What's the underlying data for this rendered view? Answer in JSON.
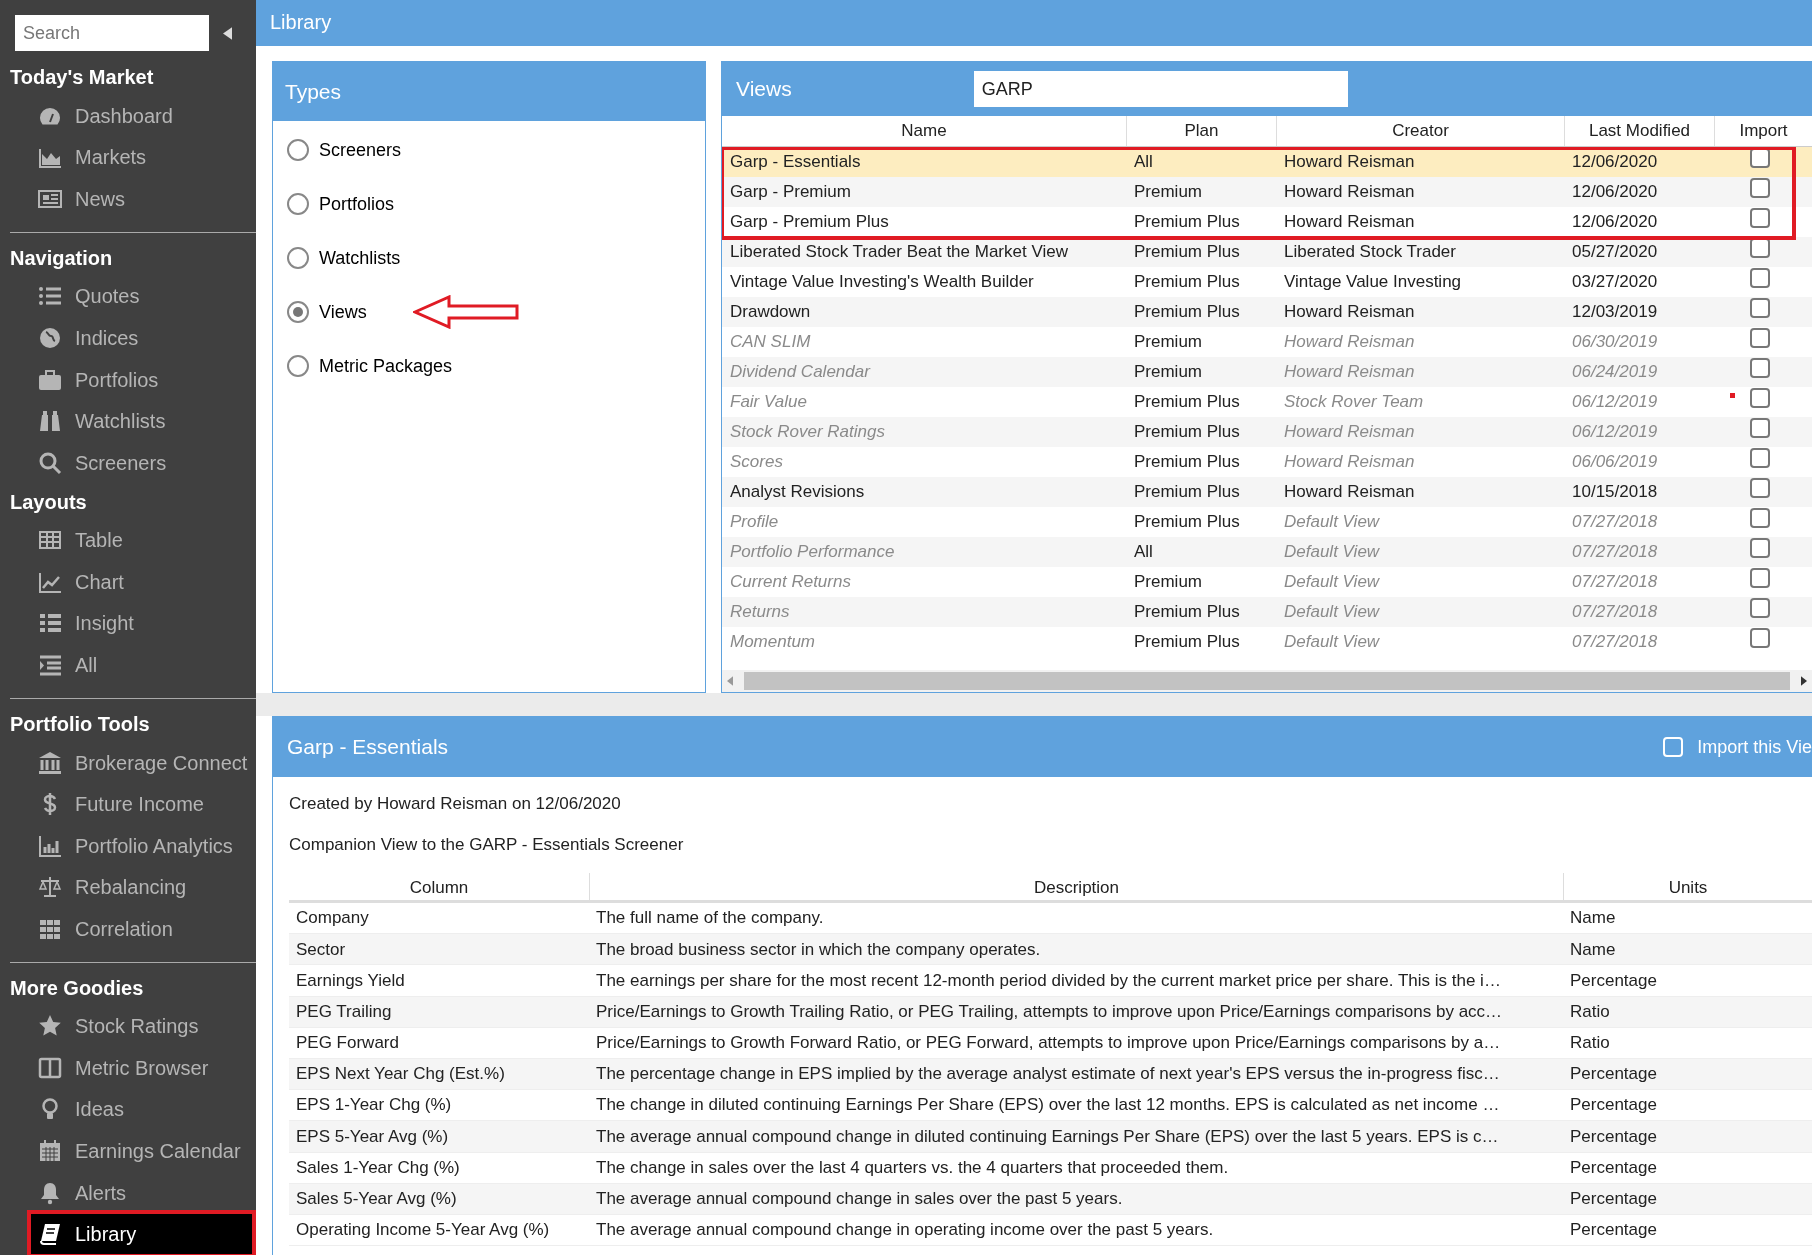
{
  "header": {
    "title": "Library"
  },
  "sidebar": {
    "search": {
      "placeholder": "Search"
    },
    "sections": [
      {
        "title": "Today's Market",
        "divider": false,
        "items": [
          {
            "label": "Dashboard",
            "selected": false,
            "outlined": false
          },
          {
            "label": "Markets",
            "selected": false,
            "outlined": false
          },
          {
            "label": "News",
            "selected": false,
            "outlined": false
          }
        ]
      },
      {
        "title": "Navigation",
        "divider": true,
        "items": [
          {
            "label": "Quotes",
            "selected": false,
            "outlined": false
          },
          {
            "label": "Indices",
            "selected": false,
            "outlined": false
          },
          {
            "label": "Portfolios",
            "selected": false,
            "outlined": false
          },
          {
            "label": "Watchlists",
            "selected": false,
            "outlined": false
          },
          {
            "label": "Screeners",
            "selected": false,
            "outlined": false
          }
        ]
      },
      {
        "title": "Layouts",
        "divider": false,
        "items": [
          {
            "label": "Table",
            "selected": false,
            "outlined": false
          },
          {
            "label": "Chart",
            "selected": false,
            "outlined": false
          },
          {
            "label": "Insight",
            "selected": false,
            "outlined": false
          },
          {
            "label": "All",
            "selected": false,
            "outlined": false
          }
        ]
      },
      {
        "title": "Portfolio Tools",
        "divider": true,
        "items": [
          {
            "label": "Brokerage Connect",
            "selected": false,
            "outlined": false
          },
          {
            "label": "Future Income",
            "selected": false,
            "outlined": false
          },
          {
            "label": "Portfolio Analytics",
            "selected": false,
            "outlined": false
          },
          {
            "label": "Rebalancing",
            "selected": false,
            "outlined": false
          },
          {
            "label": "Correlation",
            "selected": false,
            "outlined": false
          }
        ]
      },
      {
        "title": "More Goodies",
        "divider": true,
        "items": [
          {
            "label": "Stock Ratings",
            "selected": false,
            "outlined": false
          },
          {
            "label": "Metric Browser",
            "selected": false,
            "outlined": false
          },
          {
            "label": "Ideas",
            "selected": false,
            "outlined": false
          },
          {
            "label": "Earnings Calendar",
            "selected": false,
            "outlined": false
          },
          {
            "label": "Alerts",
            "selected": false,
            "outlined": false
          },
          {
            "label": "Library",
            "selected": true,
            "outlined": true
          }
        ]
      }
    ]
  },
  "types": {
    "title": "Types",
    "options": [
      {
        "label": "Screeners",
        "selected": false,
        "arrow": false
      },
      {
        "label": "Portfolios",
        "selected": false,
        "arrow": false
      },
      {
        "label": "Watchlists",
        "selected": false,
        "arrow": false
      },
      {
        "label": "Views",
        "selected": true,
        "arrow": true
      },
      {
        "label": "Metric Packages",
        "selected": false,
        "arrow": false
      }
    ]
  },
  "views": {
    "title": "Views",
    "search": {
      "value": "GARP"
    },
    "columns": [
      "Name",
      "Plan",
      "Creator",
      "Last Modified",
      "Import"
    ],
    "rows": [
      {
        "name": "Garp - Essentials",
        "plan": "All",
        "creator": "Howard Reisman",
        "modified": "12/06/2020",
        "import": false,
        "selected": true,
        "dimmed": false,
        "outlined": true
      },
      {
        "name": "Garp - Premium",
        "plan": "Premium",
        "creator": "Howard Reisman",
        "modified": "12/06/2020",
        "import": false,
        "selected": false,
        "dimmed": false,
        "outlined": true
      },
      {
        "name": "Garp - Premium Plus",
        "plan": "Premium Plus",
        "creator": "Howard Reisman",
        "modified": "12/06/2020",
        "import": false,
        "selected": false,
        "dimmed": false,
        "outlined": true
      },
      {
        "name": "Liberated Stock Trader Beat the Market View",
        "plan": "Premium Plus",
        "creator": "Liberated Stock Trader",
        "modified": "05/27/2020",
        "import": false,
        "selected": false,
        "dimmed": false,
        "outlined": false
      },
      {
        "name": "Vintage Value Investing's Wealth Builder",
        "plan": "Premium Plus",
        "creator": "Vintage Value Investing",
        "modified": "03/27/2020",
        "import": false,
        "selected": false,
        "dimmed": false,
        "outlined": false
      },
      {
        "name": "Drawdown",
        "plan": "Premium Plus",
        "creator": "Howard Reisman",
        "modified": "12/03/2019",
        "import": false,
        "selected": false,
        "dimmed": false,
        "outlined": false
      },
      {
        "name": "CAN SLIM",
        "plan": "Premium",
        "creator": "Howard Reisman",
        "modified": "06/30/2019",
        "import": false,
        "selected": false,
        "dimmed": true,
        "outlined": false
      },
      {
        "name": "Dividend Calendar",
        "plan": "Premium",
        "creator": "Howard Reisman",
        "modified": "06/24/2019",
        "import": false,
        "selected": false,
        "dimmed": true,
        "outlined": false
      },
      {
        "name": "Fair Value",
        "plan": "Premium Plus",
        "creator": "Stock Rover Team",
        "modified": "06/12/2019",
        "import": false,
        "selected": false,
        "dimmed": true,
        "outlined": false
      },
      {
        "name": "Stock Rover Ratings",
        "plan": "Premium Plus",
        "creator": "Howard Reisman",
        "modified": "06/12/2019",
        "import": false,
        "selected": false,
        "dimmed": true,
        "outlined": false
      },
      {
        "name": "Scores",
        "plan": "Premium Plus",
        "creator": "Howard Reisman",
        "modified": "06/06/2019",
        "import": false,
        "selected": false,
        "dimmed": true,
        "outlined": false
      },
      {
        "name": "Analyst Revisions",
        "plan": "Premium Plus",
        "creator": "Howard Reisman",
        "modified": "10/15/2018",
        "import": false,
        "selected": false,
        "dimmed": false,
        "outlined": false
      },
      {
        "name": "Profile",
        "plan": "Premium Plus",
        "creator": "Default View",
        "modified": "07/27/2018",
        "import": false,
        "selected": false,
        "dimmed": true,
        "outlined": false
      },
      {
        "name": "Portfolio Performance",
        "plan": "All",
        "creator": "Default View",
        "modified": "07/27/2018",
        "import": false,
        "selected": false,
        "dimmed": true,
        "outlined": false
      },
      {
        "name": "Current Returns",
        "plan": "Premium",
        "creator": "Default View",
        "modified": "07/27/2018",
        "import": false,
        "selected": false,
        "dimmed": true,
        "outlined": false
      },
      {
        "name": "Returns",
        "plan": "Premium Plus",
        "creator": "Default View",
        "modified": "07/27/2018",
        "import": false,
        "selected": false,
        "dimmed": true,
        "outlined": false
      },
      {
        "name": "Momentum",
        "plan": "Premium Plus",
        "creator": "Default View",
        "modified": "07/27/2018",
        "import": false,
        "selected": false,
        "dimmed": true,
        "outlined": false
      }
    ]
  },
  "detail": {
    "title": "Garp - Essentials",
    "import_label": "Import this Vie",
    "import_checked": false,
    "created": "Created by Howard Reisman on 12/06/2020",
    "note": "Companion View to the GARP - Essentials Screener",
    "columns": [
      "Column",
      "Description",
      "Units"
    ],
    "rows": [
      {
        "column": "Company",
        "description": "The full name of the company.",
        "units": "Name"
      },
      {
        "column": "Sector",
        "description": "The broad business sector in which the company operates.",
        "units": "Name"
      },
      {
        "column": "Earnings Yield",
        "description": "The earnings per share for the most recent 12-month period divided by the current market price per share. This is the i…",
        "units": "Percentage"
      },
      {
        "column": "PEG Trailing",
        "description": "Price/Earnings to Growth Trailing Ratio, or PEG Trailing, attempts to improve upon Price/Earnings comparisons by acc…",
        "units": "Ratio"
      },
      {
        "column": "PEG Forward",
        "description": "Price/Earnings to Growth Forward Ratio, or PEG Forward, attempts to improve upon Price/Earnings comparisons by a…",
        "units": "Ratio"
      },
      {
        "column": "EPS Next Year Chg (Est.%)",
        "description": "The percentage change in EPS implied by the average analyst estimate of next year's EPS versus the in-progress fisc…",
        "units": "Percentage"
      },
      {
        "column": "EPS 1-Year Chg (%)",
        "description": "The change in diluted continuing Earnings Per Share (EPS) over the last 12 months. EPS is calculated as net income …",
        "units": "Percentage"
      },
      {
        "column": "EPS 5-Year Avg (%)",
        "description": "The average annual compound change in diluted continuing Earnings Per Share (EPS) over the last 5 years. EPS is c…",
        "units": "Percentage"
      },
      {
        "column": "Sales 1-Year Chg (%)",
        "description": "The change in sales over the last 4 quarters vs. the 4 quarters that proceeded them.",
        "units": "Percentage"
      },
      {
        "column": "Sales 5-Year Avg (%)",
        "description": "The average annual compound change in sales over the past 5 years.",
        "units": "Percentage"
      },
      {
        "column": "Operating Income 5-Year Avg (%)",
        "description": "The average annual compound change in operating income over the past 5 years.",
        "units": "Percentage"
      }
    ]
  }
}
